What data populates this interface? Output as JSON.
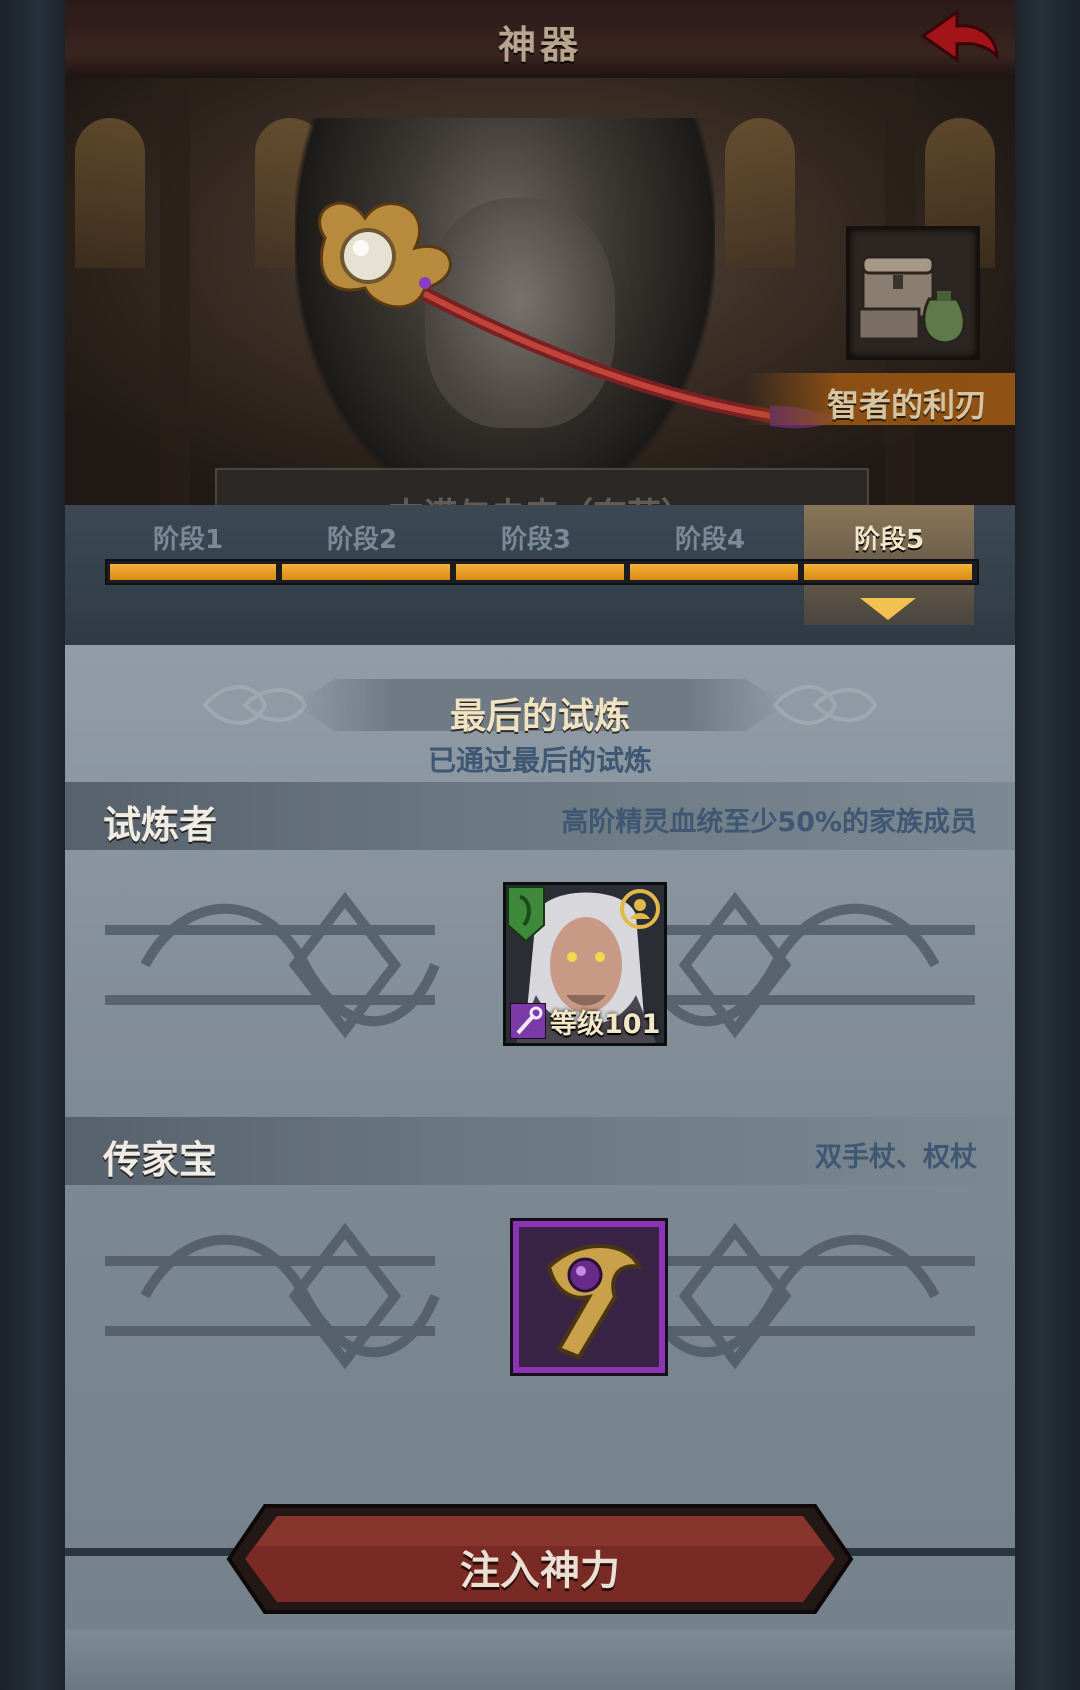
{
  "header": {
    "title": "神器"
  },
  "hero": {
    "artifact_name": "智者的利刃",
    "subtitle": "古诺与未来（奈莎）"
  },
  "stages": {
    "items": [
      "阶段1",
      "阶段2",
      "阶段3",
      "阶段4",
      "阶段5"
    ],
    "active_index": 5,
    "progress_fraction": 1.0
  },
  "trial": {
    "title": "最后的试炼",
    "status": "已通过最后的试炼"
  },
  "challenger": {
    "label": "试炼者",
    "requirement": "高阶精灵血统至少50%的家族成员",
    "hero_level": "等级101"
  },
  "heirloom": {
    "label": "传家宝",
    "requirement": "双手杖、权杖"
  },
  "action": {
    "label": "注入神力"
  },
  "colors": {
    "accent_orange": "#f2a531",
    "epic_purple": "#8c34b5",
    "button_red": "#7a2a24"
  }
}
